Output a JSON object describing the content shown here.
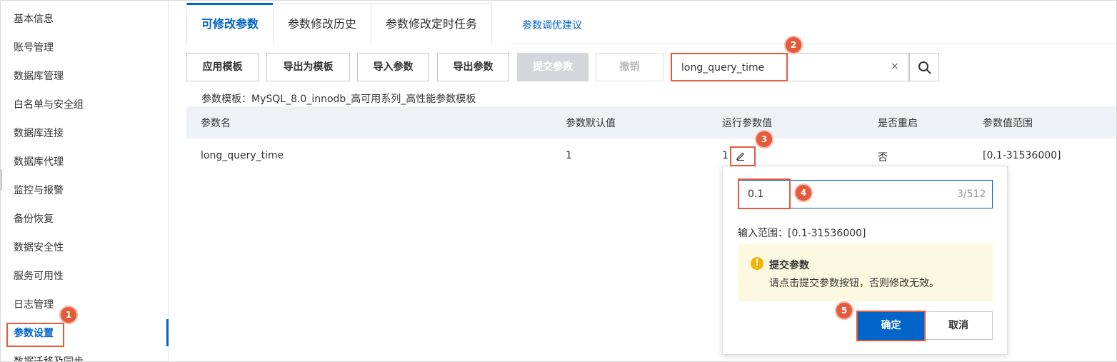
{
  "sidebar": {
    "items": [
      {
        "label": "基本信息"
      },
      {
        "label": "账号管理"
      },
      {
        "label": "数据库管理"
      },
      {
        "label": "白名单与安全组"
      },
      {
        "label": "数据库连接"
      },
      {
        "label": "数据库代理"
      },
      {
        "label": "监控与报警"
      },
      {
        "label": "备份恢复"
      },
      {
        "label": "数据安全性"
      },
      {
        "label": "服务可用性"
      },
      {
        "label": "日志管理"
      },
      {
        "label": "参数设置",
        "active": true
      },
      {
        "label": "数据迁移及同步"
      }
    ]
  },
  "tabs": [
    {
      "label": "可修改参数",
      "active": true
    },
    {
      "label": "参数修改历史"
    },
    {
      "label": "参数修改定时任务"
    }
  ],
  "tab_link": "参数调优建议",
  "toolbar": {
    "apply_template": "应用模板",
    "export_as_template": "导出为模板",
    "import_params": "导入参数",
    "export_params": "导出参数",
    "submit_params": "提交参数",
    "undo": "撤销"
  },
  "search": {
    "value": "long_query_time",
    "clear": "×"
  },
  "template_info": "参数模板：MySQL_8.0_innodb_高可用系列_高性能参数模板",
  "table": {
    "headers": [
      "参数名",
      "参数默认值",
      "运行参数值",
      "是否重启",
      "参数值范围"
    ],
    "rows": [
      {
        "name": "long_query_time",
        "default": "1",
        "running": "1",
        "restart": "否",
        "range": "[0.1-31536000]"
      }
    ]
  },
  "popover": {
    "input_value": "0.1",
    "count": "3/512",
    "range_text": "输入范围：[0.1-31536000]",
    "warning_title": "提交参数",
    "warning_text": "请点击提交参数按钮，否则修改无效。",
    "warning_icon": "!",
    "confirm": "确定",
    "cancel": "取消"
  },
  "markers": [
    "1",
    "2",
    "3",
    "4",
    "5"
  ],
  "colors": {
    "accent": "#0064c8",
    "highlight": "#e45a3b",
    "warning_bg": "#fdf8e0",
    "warning_icon": "#f5b400"
  }
}
